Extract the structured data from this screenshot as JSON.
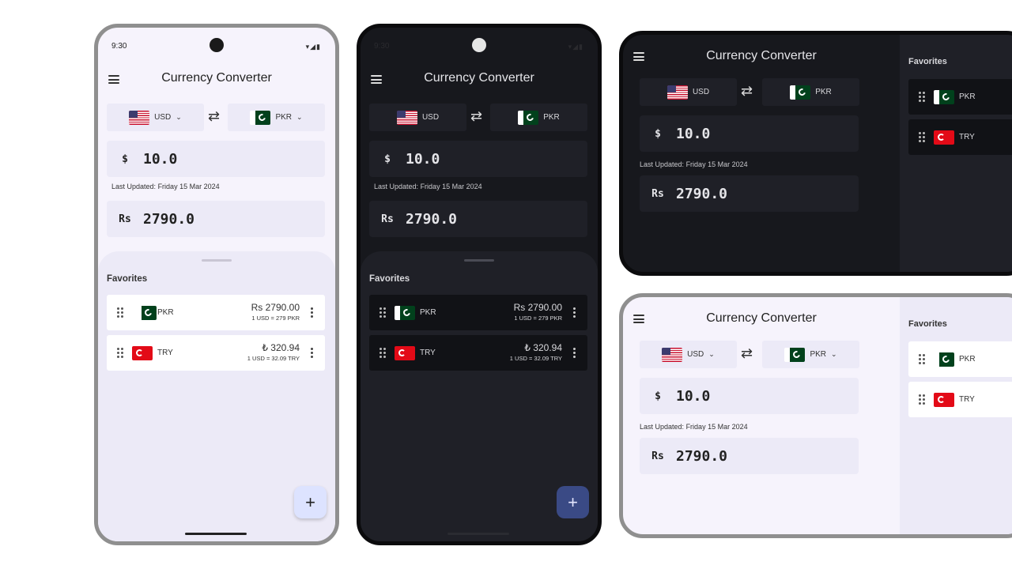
{
  "app": {
    "title": "Currency Converter",
    "status_time": "9:30",
    "status_icons": "▾◢▮",
    "last_updated_label": "Last Updated:",
    "last_updated_value": "Friday 15 Mar 2024",
    "swap_glyph": "⇄",
    "chevron": "⌄",
    "fab_glyph": "+"
  },
  "converter": {
    "from": {
      "code": "USD",
      "symbol": "$",
      "amount": "10.0",
      "flag": "us-flag-icon"
    },
    "to": {
      "code": "PKR",
      "symbol": "Rs",
      "amount": "2790.0",
      "flag": "pk-flag-icon"
    }
  },
  "favorites": {
    "title": "Favorites",
    "items": [
      {
        "code": "PKR",
        "symbol": "Rs",
        "value": "2790.00",
        "rate": "1 USD = 279 PKR",
        "flag": "pk-flag-icon"
      },
      {
        "code": "TRY",
        "symbol": "₺",
        "value": "320.94",
        "rate": "1 USD = 32.09 TRY",
        "flag": "tr-flag-icon"
      }
    ]
  },
  "colors": {
    "light_bg": "#f6f3fc",
    "light_surface": "#eceaf7",
    "light_card": "#ffffff",
    "dark_bg": "#17181d",
    "dark_surface": "#1f2027",
    "dark_card": "#111216",
    "fab_light": "#dde3ff",
    "fab_dark": "#3a4a85"
  }
}
